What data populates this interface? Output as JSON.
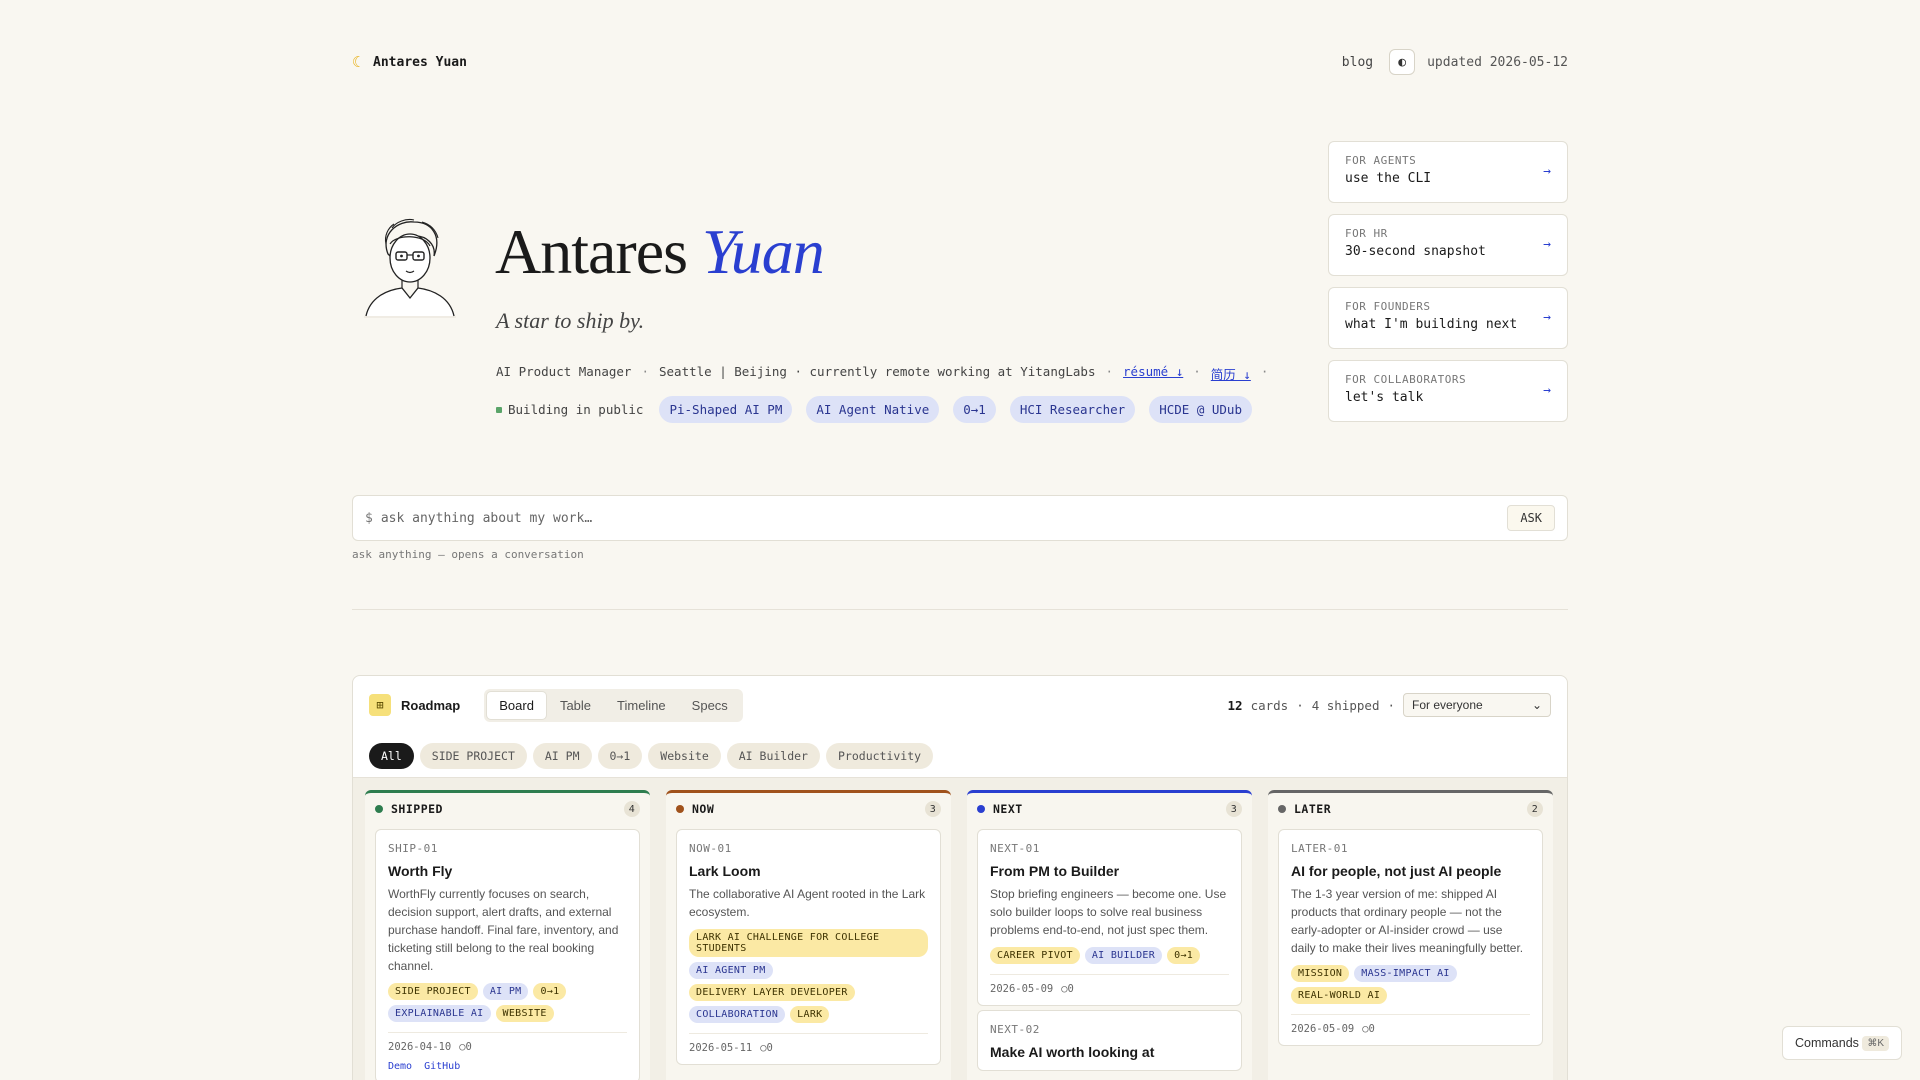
{
  "brand": {
    "icon": "crescent-moon-icon",
    "name": "Antares Yuan"
  },
  "topnav": {
    "blog": "blog",
    "theme_icon": "◐",
    "updated": "updated 2026-05-12"
  },
  "hero": {
    "name_first": "Antares ",
    "name_last": "Yuan",
    "tagline": "A star to ship by.",
    "role": "AI Product Manager",
    "location": "Seattle | Beijing · currently remote working at YitangLabs",
    "resume": "résumé ↓",
    "resume_cn": "简历 ↓",
    "status": "Building in public",
    "tags": [
      "Pi-Shaped AI PM",
      "AI Agent Native",
      "0→1",
      "HCI Researcher",
      "HCDE @ UDub"
    ]
  },
  "audiences": [
    {
      "label": "FOR AGENTS",
      "value": "use the CLI"
    },
    {
      "label": "FOR HR",
      "value": "30-second snapshot"
    },
    {
      "label": "FOR FOUNDERS",
      "value": "what I'm building next"
    },
    {
      "label": "FOR COLLABORATORS",
      "value": "let's talk"
    }
  ],
  "ask": {
    "prompt": "$",
    "placeholder": "ask anything about my work…",
    "button": "ASK",
    "hint": "ask anything — opens a conversation"
  },
  "roadmap": {
    "title": "Roadmap",
    "views": [
      "Board",
      "Table",
      "Timeline",
      "Specs"
    ],
    "count": "12",
    "count_suffix": "cards",
    "shipped": "4 shipped",
    "audience_select": "For everyone",
    "filters": [
      "All",
      "SIDE PROJECT",
      "AI PM",
      "0→1",
      "Website",
      "AI Builder",
      "Productivity"
    ],
    "columns": [
      {
        "name": "SHIPPED",
        "count": "4",
        "color": "#2e7d4f",
        "cards": [
          {
            "id": "SHIP-01",
            "title": "Worth Fly",
            "desc": "WorthFly currently focuses on search, decision support, alert drafts, and external purchase handoff. Final fare, inventory, and ticketing still belong to the real booking channel.",
            "tags": [
              [
                "SIDE PROJECT",
                "y"
              ],
              [
                "AI PM",
                "b"
              ],
              [
                "0→1",
                "y"
              ],
              [
                "EXPLAINABLE AI",
                "b"
              ],
              [
                "WEBSITE",
                "y"
              ]
            ],
            "date": "2026-04-10",
            "comments": "0",
            "links": [
              "Demo",
              "GitHub"
            ]
          }
        ]
      },
      {
        "name": "NOW",
        "count": "3",
        "color": "#a0521c",
        "cards": [
          {
            "id": "NOW-01",
            "title": "Lark Loom",
            "desc": "The collaborative AI Agent rooted in the Lark ecosystem.",
            "tags": [
              [
                "LARK AI CHALLENGE FOR COLLEGE STUDENTS",
                "y"
              ],
              [
                "AI AGENT PM",
                "b"
              ],
              [
                "DELIVERY LAYER DEVELOPER",
                "y"
              ],
              [
                "COLLABORATION",
                "b"
              ],
              [
                "LARK",
                "y"
              ]
            ],
            "date": "2026-05-11",
            "comments": "0"
          }
        ]
      },
      {
        "name": "NEXT",
        "count": "3",
        "color": "#2a3fd0",
        "cards": [
          {
            "id": "NEXT-01",
            "title": "From PM to Builder",
            "desc": "Stop briefing engineers — become one. Use solo builder loops to solve real business problems end-to-end, not just spec them.",
            "tags": [
              [
                "CAREER PIVOT",
                "y"
              ],
              [
                "AI BUILDER",
                "b"
              ],
              [
                "0→1",
                "y"
              ]
            ],
            "date": "2026-05-09",
            "comments": "0"
          },
          {
            "id": "NEXT-02",
            "title": "Make AI worth looking at"
          }
        ]
      },
      {
        "name": "LATER",
        "count": "2",
        "color": "#666666",
        "cards": [
          {
            "id": "LATER-01",
            "title": "AI for people, not just AI people",
            "desc": "The 1-3 year version of me: shipped AI products that ordinary people — not the early-adopter or AI-insider crowd — use daily to make their lives meaningfully better.",
            "tags": [
              [
                "MISSION",
                "y"
              ],
              [
                "MASS-IMPACT AI",
                "b"
              ],
              [
                "REAL-WORLD AI",
                "y"
              ]
            ],
            "date": "2026-05-09",
            "comments": "0"
          }
        ]
      }
    ]
  },
  "commands": {
    "label": "Commands",
    "shortcut": "⌘K"
  }
}
